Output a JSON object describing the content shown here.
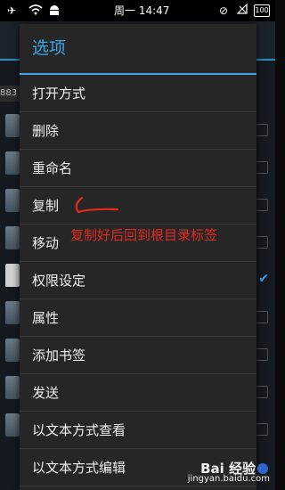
{
  "status_bar": {
    "time": "周一 14:47",
    "battery": "100"
  },
  "background": {
    "path_text": "883"
  },
  "dialog": {
    "title": "选项",
    "items": [
      {
        "label": "打开方式"
      },
      {
        "label": "删除"
      },
      {
        "label": "重命名"
      },
      {
        "label": "复制"
      },
      {
        "label": "移动"
      },
      {
        "label": "权限设定"
      },
      {
        "label": "属性"
      },
      {
        "label": "添加书签"
      },
      {
        "label": "发送"
      },
      {
        "label": "以文本方式查看"
      },
      {
        "label": "以文本方式编辑"
      }
    ]
  },
  "annotation": {
    "text": "复制好后回到根目录标签",
    "color": "#e22a1f"
  },
  "watermark": {
    "main": "Bai 经验",
    "sub": "jingyan.baidu.com"
  },
  "colors": {
    "accent": "#3ea4e6",
    "dialog_bg": "#262626"
  }
}
